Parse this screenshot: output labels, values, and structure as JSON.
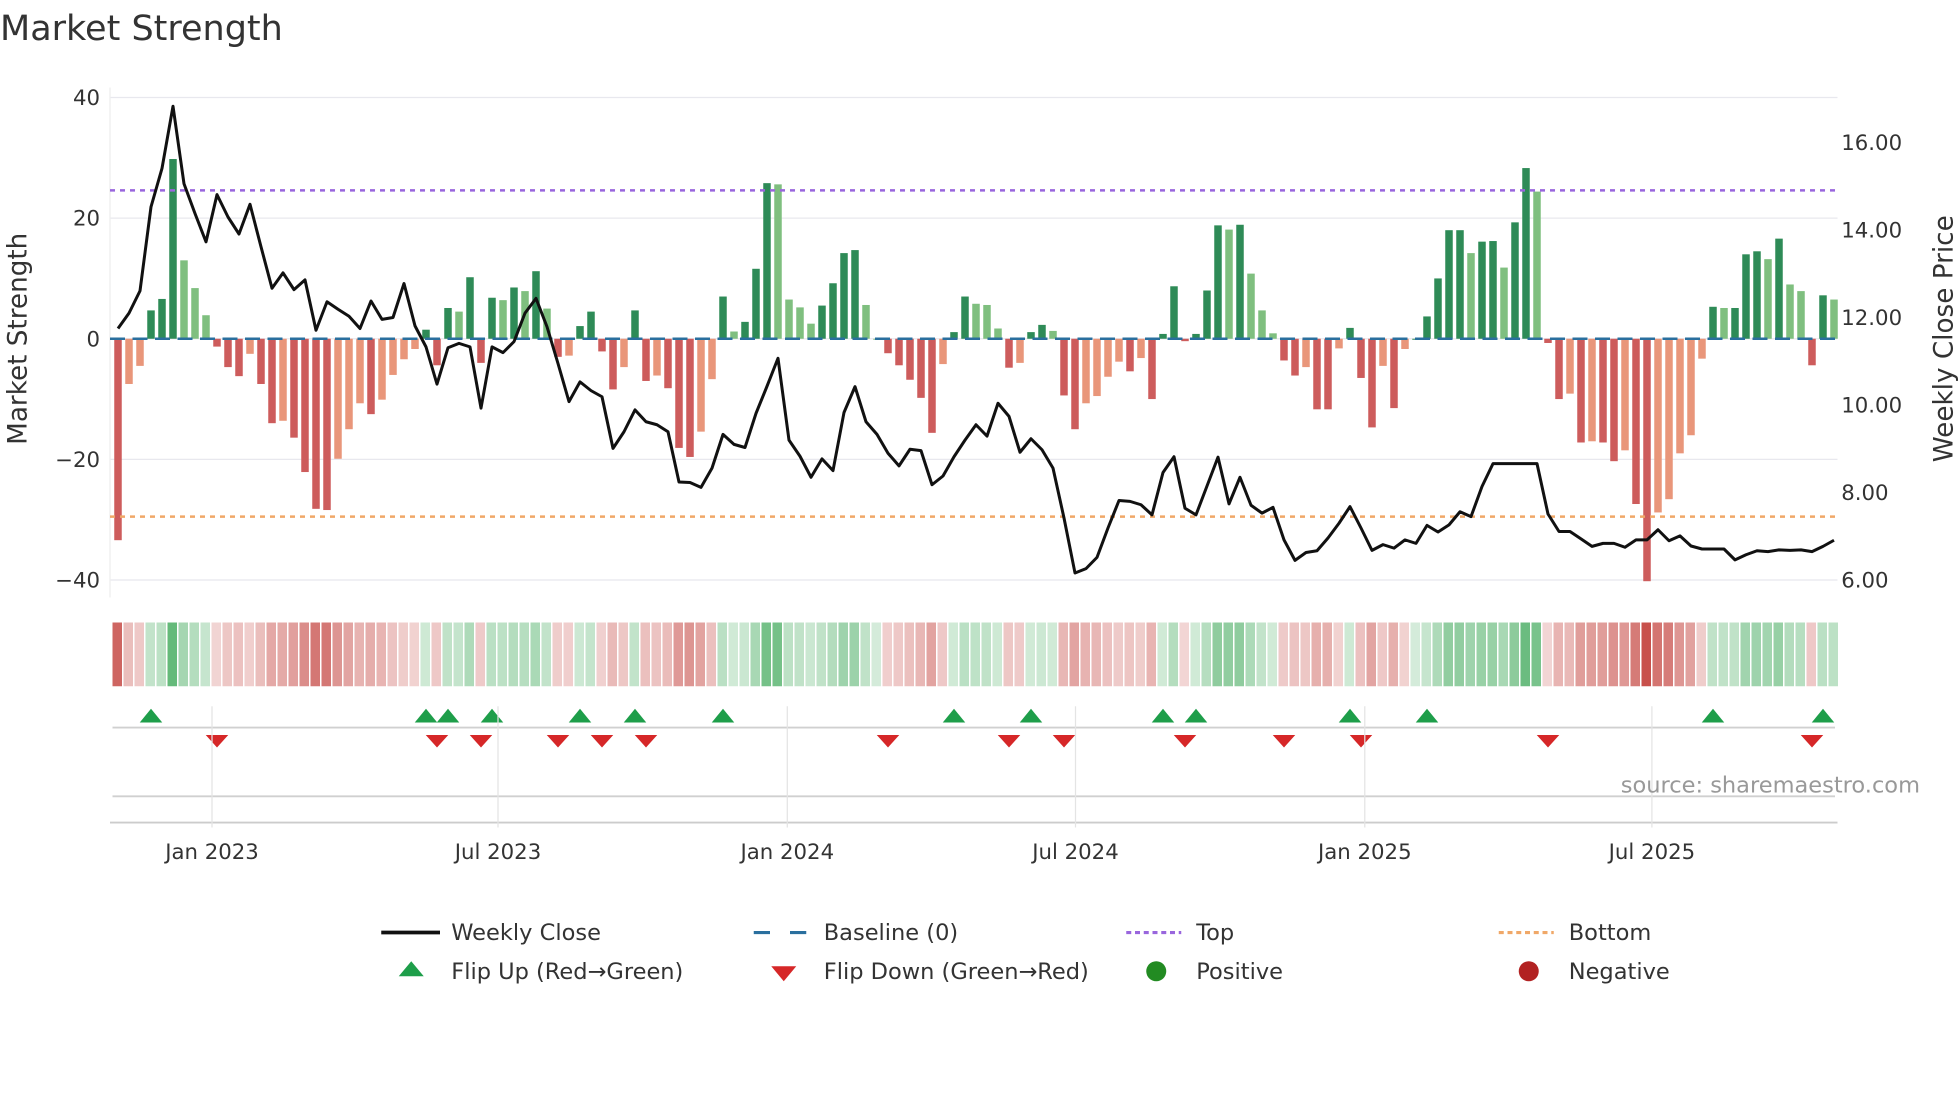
{
  "chart_data": {
    "type": "bar",
    "title": "Market Strength",
    "ylabel": "Market Strength",
    "y2label": "Weekly Close Price",
    "ylim": [
      -40,
      40
    ],
    "y2lim": [
      6,
      16
    ],
    "yticks": [
      "40",
      "20",
      "0",
      "−20",
      "−40"
    ],
    "ytick_values": [
      40,
      20,
      0,
      -20,
      -40
    ],
    "y2ticks": [
      "16.00",
      "14.00",
      "12.00",
      "10.00",
      "8.00",
      "6.00"
    ],
    "y2tick_values": [
      16,
      14,
      12,
      10,
      8,
      6
    ],
    "xticks": [
      "Jan 2023",
      "Jul 2023",
      "Jan 2024",
      "Jul 2024",
      "Jan 2025",
      "Jul 2025"
    ],
    "xtick_week_index": [
      9,
      35,
      61.3,
      87.5,
      113.8,
      139.9
    ],
    "top_level": 24.6,
    "bottom_level": -29.5,
    "grid": true,
    "legend_placement": "bottom-center",
    "source": "source: sharemaestro.com",
    "strength": [
      -33.4,
      -7.5,
      -4.5,
      4.7,
      6.6,
      29.8,
      13,
      8.4,
      3.9,
      -1.3,
      -4.7,
      -6.2,
      -2.5,
      -7.5,
      -14,
      -13.6,
      -16.4,
      -22.1,
      -28.2,
      -28.4,
      -19.9,
      -15,
      -10.7,
      -12.5,
      -10.1,
      -6,
      -3.4,
      -1.7,
      1.5,
      -4.4,
      5.1,
      4.5,
      10.2,
      -4,
      6.8,
      6.4,
      8.5,
      7.9,
      11.2,
      5,
      -3,
      -2.8,
      2.1,
      4.5,
      -2.1,
      -8.4,
      -4.7,
      4.7,
      -7,
      -6.1,
      -8.2,
      -18.1,
      -19.6,
      -15.4,
      -6.7,
      7,
      1.2,
      2.8,
      11.6,
      25.8,
      25.6,
      6.5,
      5.2,
      2.5,
      5.5,
      9.2,
      14.2,
      14.7,
      5.6,
      0,
      -2.4,
      -4.4,
      -6.8,
      -9.8,
      -15.6,
      -4.2,
      1.1,
      7,
      5.8,
      5.6,
      1.7,
      -4.8,
      -4,
      1.1,
      2.3,
      1.3,
      -9.4,
      -15,
      -10.7,
      -9.5,
      -6.3,
      -3.8,
      -5.4,
      -3.2,
      -10,
      0.8,
      8.7,
      -0.4,
      0.8,
      8,
      18.8,
      18.1,
      18.9,
      10.8,
      4.7,
      0.9,
      -3.6,
      -6.1,
      -4.7,
      -11.7,
      -11.7,
      -1.6,
      1.8,
      -6.5,
      -14.7,
      -4.5,
      -11.5,
      -1.7,
      0,
      3.7,
      10,
      18,
      18,
      14.2,
      16.1,
      16.2,
      11.8,
      19.3,
      28.3,
      24.4,
      -0.7,
      -10,
      -9.1,
      -17.2,
      -17,
      -17.2,
      -20.3,
      -18.5,
      -27.4,
      -40.2,
      -28.8,
      -26.6,
      -19,
      -16,
      -3.3,
      5.3,
      5.1,
      5.1,
      14,
      14.5,
      13.2,
      16.6,
      9,
      7.9,
      -4.4,
      7.2,
      6.5
    ],
    "weekly_close": [
      11.72,
      12.07,
      12.58,
      14.5,
      15.38,
      16.8,
      15.03,
      14.35,
      13.7,
      14.78,
      14.27,
      13.88,
      14.56,
      13.59,
      12.64,
      12.99,
      12.61,
      12.83,
      11.68,
      12.33,
      12.16,
      12,
      11.72,
      12.35,
      11.93,
      11.97,
      12.75,
      11.78,
      11.3,
      10.45,
      11.28,
      11.38,
      11.3,
      9.9,
      11.3,
      11.17,
      11.42,
      12.07,
      12.41,
      11.76,
      10.92,
      10.05,
      10.5,
      10.3,
      10.16,
      8.98,
      9.36,
      9.86,
      9.59,
      9.52,
      9.36,
      8.21,
      8.2,
      8.09,
      8.53,
      9.3,
      9.07,
      9,
      9.78,
      10.4,
      11.04,
      9.17,
      8.8,
      8.32,
      8.74,
      8.47,
      9.8,
      10.39,
      9.59,
      9.3,
      8.87,
      8.58,
      8.96,
      8.93,
      8.15,
      8.35,
      8.79,
      9.17,
      9.52,
      9.26,
      10.01,
      9.71,
      8.89,
      9.2,
      8.95,
      8.53,
      7.39,
      6.13,
      6.23,
      6.49,
      7.16,
      7.79,
      7.77,
      7.69,
      7.46,
      8.43,
      8.79,
      7.61,
      7.46,
      8.12,
      8.78,
      7.71,
      8.32,
      7.68,
      7.5,
      7.63,
      6.89,
      6.42,
      6.6,
      6.64,
      6.93,
      7.27,
      7.65,
      7.16,
      6.65,
      6.78,
      6.7,
      6.89,
      6.81,
      7.22,
      7.07,
      7.23,
      7.53,
      7.42,
      8.11,
      8.63,
      8.63,
      8.63,
      8.63,
      8.63,
      7.48,
      7.08,
      7.08,
      6.91,
      6.74,
      6.81,
      6.81,
      6.72,
      6.89,
      6.89,
      7.12,
      6.87,
      6.98,
      6.75,
      6.68,
      6.68,
      6.68,
      6.43,
      6.55,
      6.64,
      6.62,
      6.66,
      6.65,
      6.66,
      6.62,
      6.74,
      6.88
    ],
    "legend": [
      {
        "label": "Weekly Close",
        "symbol": "line"
      },
      {
        "label": "Baseline (0)",
        "symbol": "dash"
      },
      {
        "label": "Top",
        "symbol": "dot-purple"
      },
      {
        "label": "Bottom",
        "symbol": "dot-orange"
      },
      {
        "label": "Flip Up (Red→Green)",
        "symbol": "triangle-up"
      },
      {
        "label": "Flip Down (Green→Red)",
        "symbol": "triangle-down"
      },
      {
        "label": "Positive",
        "symbol": "circle-green"
      },
      {
        "label": "Negative",
        "symbol": "circle-red"
      }
    ],
    "colors": {
      "rise_pos": "#2e8b57",
      "fall_pos": "#7fbf7f",
      "fall_neg": "#cd5c5c",
      "rise_neg": "#e9967a",
      "line": "#111111",
      "baseline": "#2a6f9e",
      "top": "#9966dd",
      "bottom": "#f0a868",
      "flip_up": "#1e9e4a",
      "flip_down": "#d62728",
      "positive": "#228b22",
      "negative": "#b22222"
    }
  }
}
